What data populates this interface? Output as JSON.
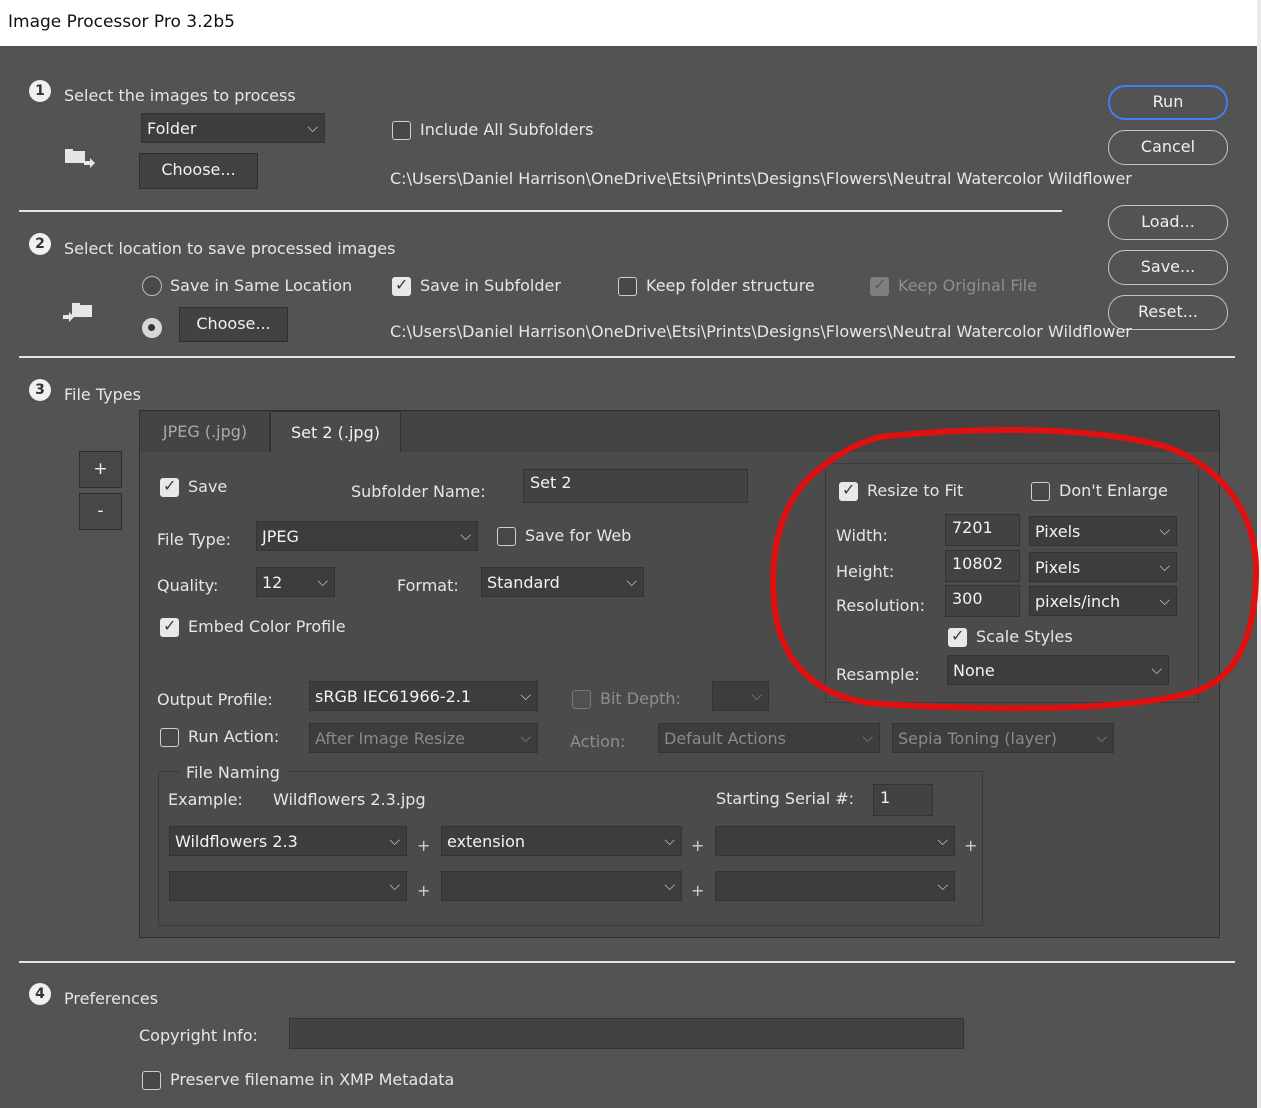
{
  "window": {
    "title": "Image Processor Pro 3.2b5"
  },
  "step1": {
    "num": "1",
    "title": "Select the images to process",
    "source_select": "Folder",
    "include_subfolders_label": "Include All Subfolders",
    "include_subfolders_checked": false,
    "choose_label": "Choose...",
    "path": "C:\\Users\\Daniel Harrison\\OneDrive\\Etsi\\Prints\\Designs\\Flowers\\Neutral Watercolor Wildflower"
  },
  "step2": {
    "num": "2",
    "title": "Select location to save processed images",
    "same_location_label": "Save in Same Location",
    "save_in_subfolder_label": "Save in Subfolder",
    "keep_folder_structure_label": "Keep folder structure",
    "keep_original_label": "Keep Original File",
    "choose_label": "Choose...",
    "path": "C:\\Users\\Daniel Harrison\\OneDrive\\Etsi\\Prints\\Designs\\Flowers\\Neutral Watercolor Wildflower"
  },
  "buttons": {
    "run": "Run",
    "cancel": "Cancel",
    "load": "Load...",
    "save": "Save...",
    "reset": "Reset..."
  },
  "step3": {
    "num": "3",
    "title": "File Types",
    "add_set": "+",
    "remove_set": "-",
    "tabs": [
      "JPEG (.jpg)",
      "Set 2 (.jpg)"
    ],
    "active_tab": 1,
    "save_label": "Save",
    "subfolder_name_label": "Subfolder Name:",
    "subfolder_name": "Set 2",
    "file_type_label": "File Type:",
    "file_type": "JPEG",
    "save_for_web_label": "Save for Web",
    "quality_label": "Quality:",
    "quality": "12",
    "format_label": "Format:",
    "format": "Standard",
    "embed_color_label": "Embed Color Profile",
    "output_profile_label": "Output Profile:",
    "output_profile": "sRGB IEC61966-2.1",
    "bit_depth_label": "Bit Depth:",
    "bit_depth": "",
    "run_action_label": "Run Action:",
    "run_action_when": "After Image Resize",
    "action_label": "Action:",
    "action_set": "Default Actions",
    "action_name": "Sepia Toning (layer)",
    "resize": {
      "resize_to_fit_label": "Resize to Fit",
      "dont_enlarge_label": "Don't Enlarge",
      "width_label": "Width:",
      "width": "7201",
      "width_unit": "Pixels",
      "height_label": "Height:",
      "height": "10802",
      "height_unit": "Pixels",
      "resolution_label": "Resolution:",
      "resolution": "300",
      "resolution_unit": "pixels/inch",
      "scale_styles_label": "Scale Styles",
      "resample_label": "Resample:",
      "resample": "None"
    },
    "naming": {
      "title": "File Naming",
      "example_label": "Example:",
      "example": "Wildflowers 2.3.jpg",
      "serial_label": "Starting Serial #:",
      "serial": "1",
      "row1": [
        "Wildflowers 2.3",
        "extension",
        ""
      ],
      "row2": [
        "",
        "",
        ""
      ],
      "plus": "+"
    }
  },
  "step4": {
    "num": "4",
    "title": "Preferences",
    "copyright_label": "Copyright Info:",
    "copyright": "",
    "preserve_filename_label": "Preserve filename in XMP Metadata"
  },
  "colors": {
    "annotation": "#e01010",
    "accent": "#3b82f6",
    "background": "#535353"
  }
}
